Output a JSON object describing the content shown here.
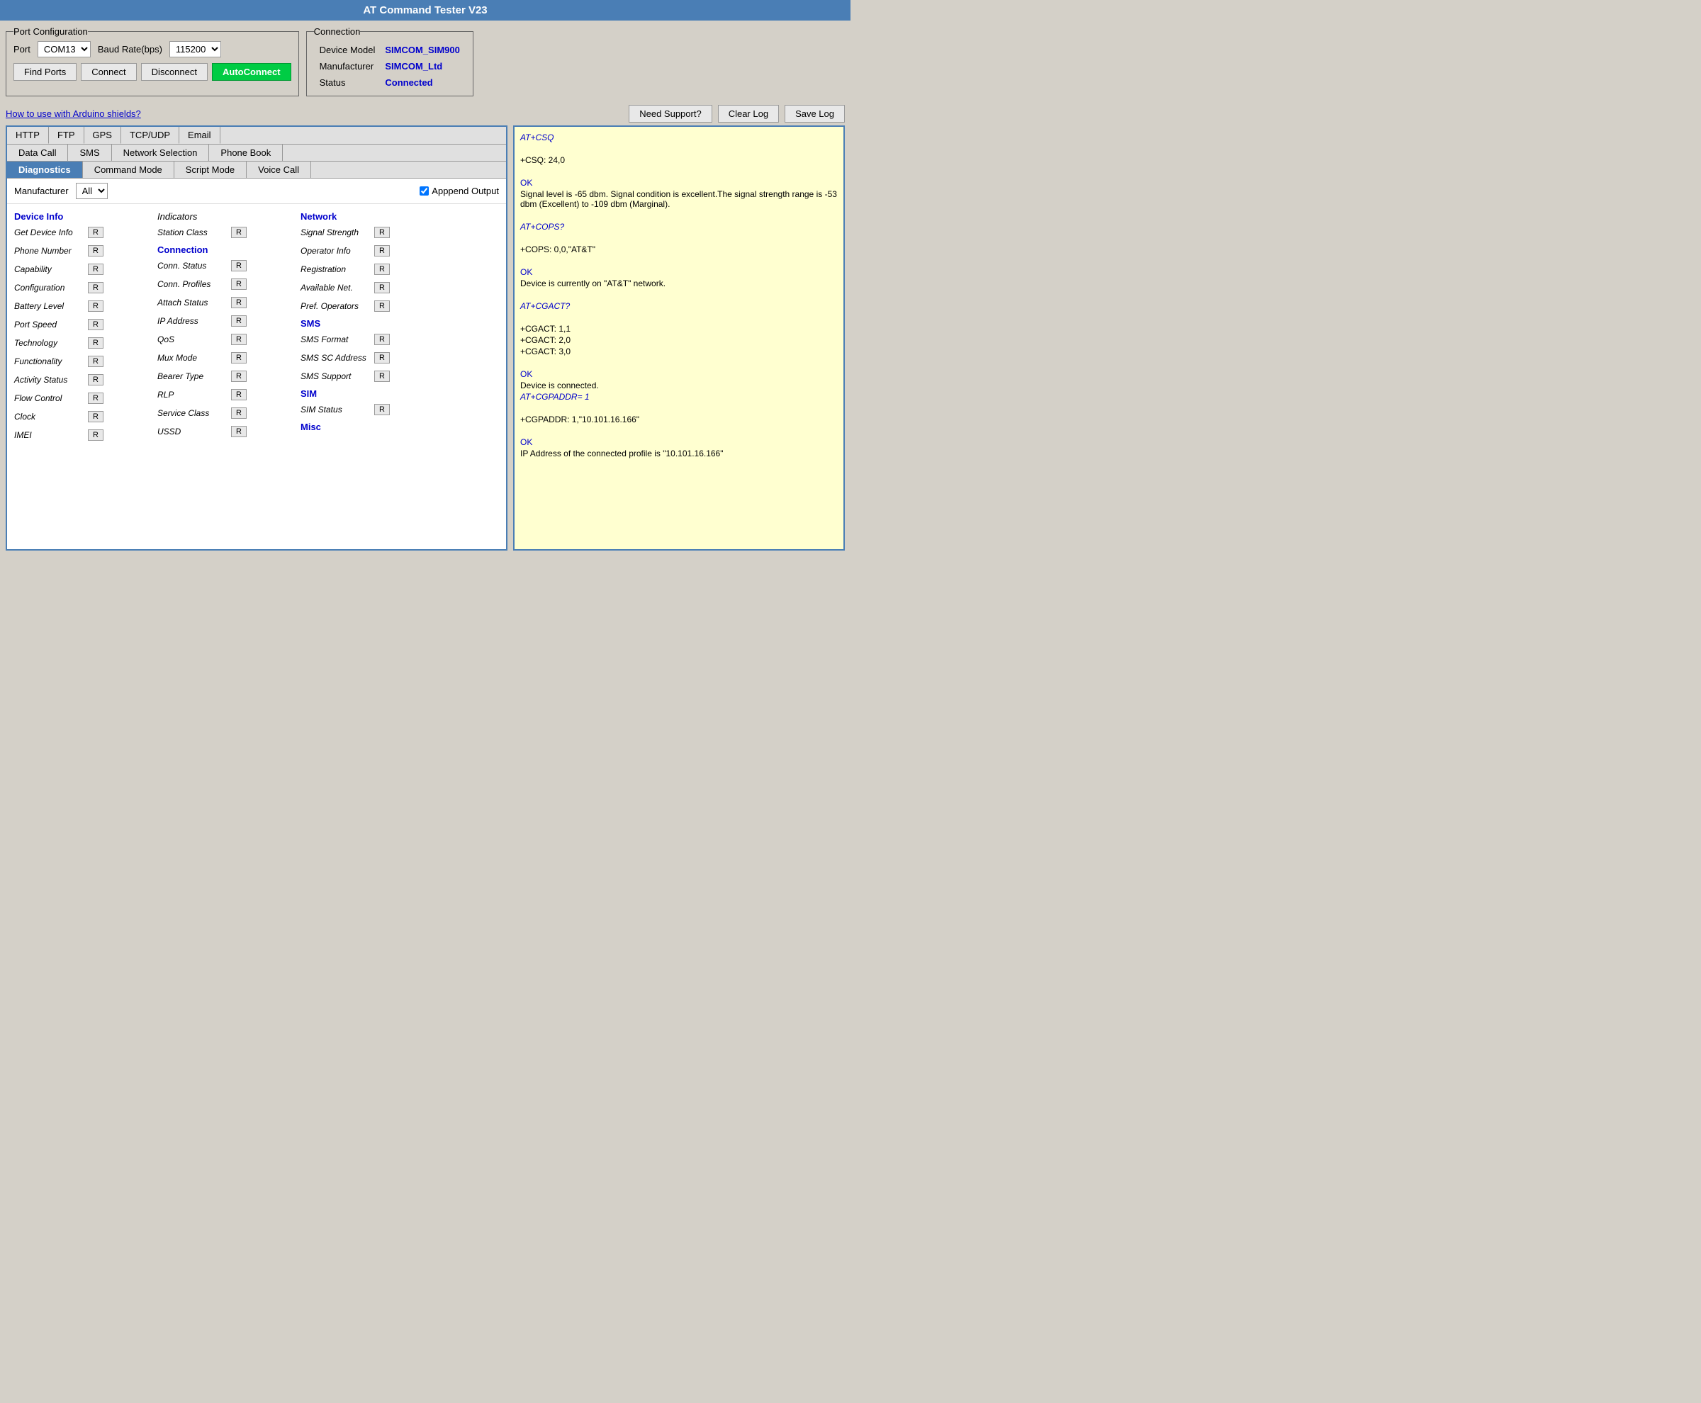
{
  "app": {
    "title": "AT Command Tester V23"
  },
  "port_config": {
    "label": "Port Configuration",
    "port_label": "Port",
    "port_value": "COM13",
    "baud_label": "Baud Rate(bps)",
    "baud_value": "115200",
    "find_ports": "Find Ports",
    "connect": "Connect",
    "disconnect": "Disconnect",
    "autoconnect": "AutoConnect"
  },
  "connection": {
    "label": "Connection",
    "device_model_label": "Device Model",
    "device_model_value": "SIMCOM_SIM900",
    "manufacturer_label": "Manufacturer",
    "manufacturer_value": "SIMCOM_Ltd",
    "status_label": "Status",
    "status_value": "Connected"
  },
  "toolbar": {
    "how_to": "How to use with Arduino shields?",
    "need_support": "Need Support?",
    "clear_log": "Clear Log",
    "save_log": "Save Log"
  },
  "tabs_row1": [
    "HTTP",
    "FTP",
    "GPS",
    "TCP/UDP",
    "Email"
  ],
  "tabs_row2": [
    "Data Call",
    "SMS",
    "Network Selection",
    "Phone Book"
  ],
  "tabs_row3": [
    "Diagnostics",
    "Command Mode",
    "Script Mode",
    "Voice Call"
  ],
  "filter": {
    "manufacturer_label": "Manufacturer",
    "manufacturer_value": "All",
    "append_label": "Apppend Output"
  },
  "diagnostics": {
    "col1": {
      "title": "Device Info",
      "items": [
        {
          "label": "Get Device Info",
          "has_btn": true
        },
        {
          "label": "Phone Number",
          "has_btn": true
        },
        {
          "label": "Capability",
          "has_btn": true
        },
        {
          "label": "Configuration",
          "has_btn": true
        },
        {
          "label": "Battery Level",
          "has_btn": true
        },
        {
          "label": "Port Speed",
          "has_btn": true
        },
        {
          "label": "Technology",
          "has_btn": true
        },
        {
          "label": "Functionality",
          "has_btn": true
        },
        {
          "label": "Activity Status",
          "has_btn": true
        },
        {
          "label": "Flow Control",
          "has_btn": true
        },
        {
          "label": "Clock",
          "has_btn": true
        },
        {
          "label": "IMEI",
          "has_btn": true
        }
      ]
    },
    "col2": {
      "items": [
        {
          "label": "Indicators",
          "has_btn": false,
          "is_section": false
        },
        {
          "label": "Station Class",
          "has_btn": true
        },
        {
          "label": "Connection",
          "has_btn": false,
          "is_section": true
        },
        {
          "label": "Conn. Status",
          "has_btn": true
        },
        {
          "label": "Conn. Profiles",
          "has_btn": true
        },
        {
          "label": "Attach Status",
          "has_btn": true
        },
        {
          "label": "IP Address",
          "has_btn": true
        },
        {
          "label": "QoS",
          "has_btn": true
        },
        {
          "label": "Mux Mode",
          "has_btn": true
        },
        {
          "label": "Bearer Type",
          "has_btn": true
        },
        {
          "label": "RLP",
          "has_btn": true
        },
        {
          "label": "Service Class",
          "has_btn": true
        },
        {
          "label": "USSD",
          "has_btn": true
        }
      ]
    },
    "col3": {
      "items": [
        {
          "label": "Network",
          "has_btn": false,
          "is_section": true
        },
        {
          "label": "Signal Strength",
          "has_btn": true
        },
        {
          "label": "Operator Info",
          "has_btn": true
        },
        {
          "label": "Registration",
          "has_btn": true
        },
        {
          "label": "Available Net.",
          "has_btn": true
        },
        {
          "label": "Pref. Operators",
          "has_btn": true
        },
        {
          "label": "SMS",
          "has_btn": false,
          "is_section": true
        },
        {
          "label": "SMS Format",
          "has_btn": true
        },
        {
          "label": "SMS SC Address",
          "has_btn": true
        },
        {
          "label": "SMS Support",
          "has_btn": true
        },
        {
          "label": "SIM",
          "has_btn": false,
          "is_section": true
        },
        {
          "label": "SIM Status",
          "has_btn": true
        },
        {
          "label": "Misc",
          "has_btn": false,
          "is_section": true
        }
      ]
    }
  },
  "log": [
    {
      "type": "cmd",
      "text": "AT+CSQ"
    },
    {
      "type": "response",
      "text": ""
    },
    {
      "type": "response",
      "text": "+CSQ: 24,0"
    },
    {
      "type": "response",
      "text": ""
    },
    {
      "type": "ok",
      "text": "OK"
    },
    {
      "type": "info",
      "text": "Signal level is -65 dbm. Signal condition is excellent.The signal strength range is -53 dbm (Excellent) to -109 dbm (Marginal)."
    },
    {
      "type": "response",
      "text": ""
    },
    {
      "type": "cmd",
      "text": "AT+COPS?"
    },
    {
      "type": "response",
      "text": ""
    },
    {
      "type": "response",
      "text": "+COPS: 0,0,\"AT&T\""
    },
    {
      "type": "response",
      "text": ""
    },
    {
      "type": "ok",
      "text": "OK"
    },
    {
      "type": "info",
      "text": "Device is currently on \"AT&T\" network."
    },
    {
      "type": "response",
      "text": ""
    },
    {
      "type": "cmd",
      "text": "AT+CGACT?"
    },
    {
      "type": "response",
      "text": ""
    },
    {
      "type": "response",
      "text": "+CGACT: 1,1"
    },
    {
      "type": "response",
      "text": "+CGACT: 2,0"
    },
    {
      "type": "response",
      "text": "+CGACT: 3,0"
    },
    {
      "type": "response",
      "text": ""
    },
    {
      "type": "ok",
      "text": "OK"
    },
    {
      "type": "info",
      "text": "Device is connected."
    },
    {
      "type": "cmd",
      "text": "AT+CGPADDR= 1"
    },
    {
      "type": "response",
      "text": ""
    },
    {
      "type": "response",
      "text": "+CGPADDR: 1,\"10.101.16.166\""
    },
    {
      "type": "response",
      "text": ""
    },
    {
      "type": "ok",
      "text": "OK"
    },
    {
      "type": "info",
      "text": "IP Address of the connected profile is \"10.101.16.166\""
    }
  ]
}
